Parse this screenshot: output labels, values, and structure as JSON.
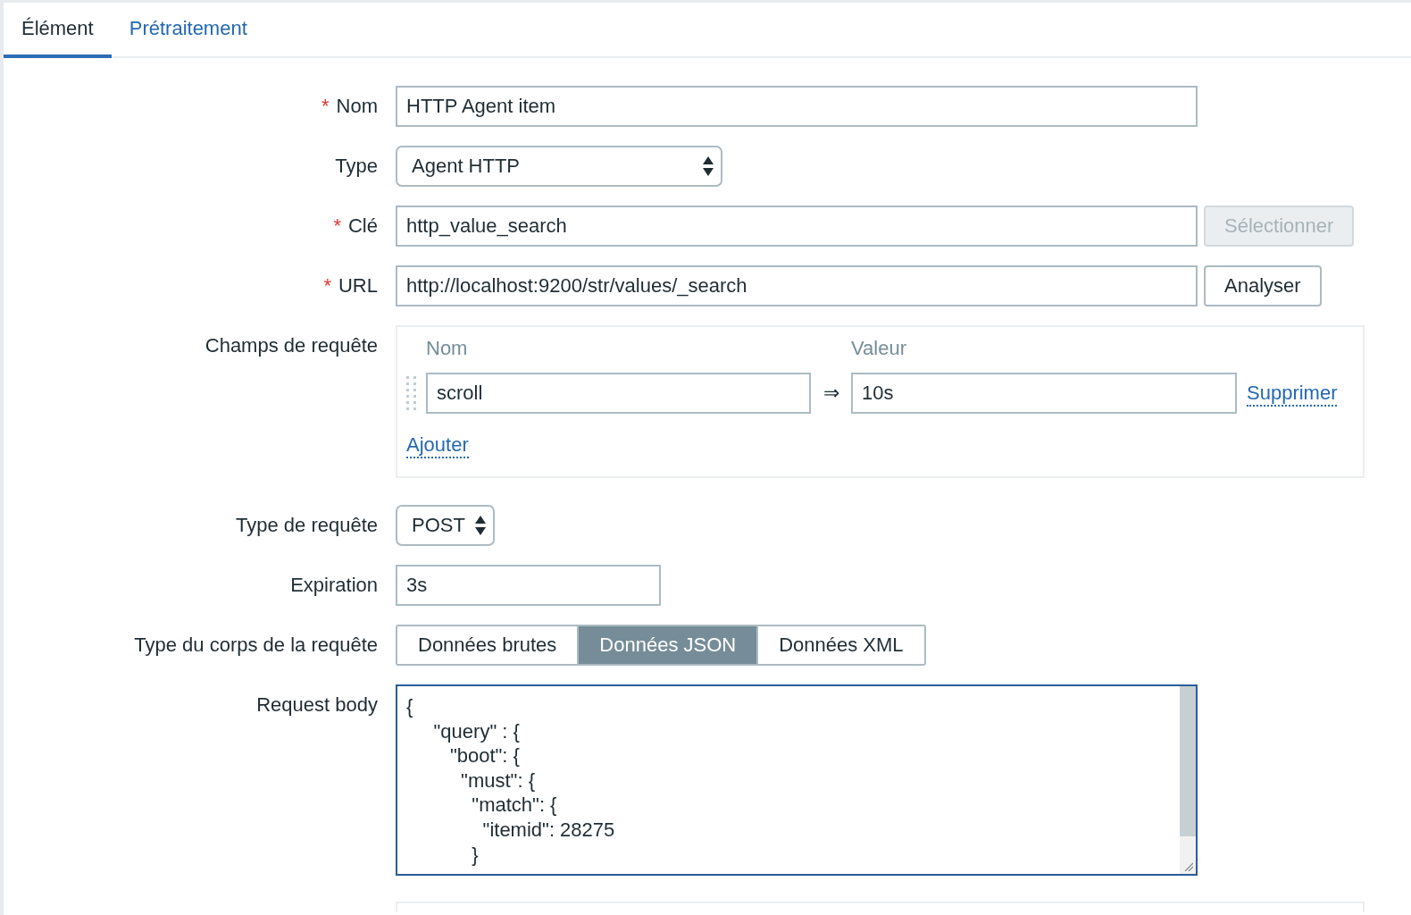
{
  "tabs": [
    {
      "label": "Élément",
      "selected": true
    },
    {
      "label": "Prétraitement",
      "selected": false
    }
  ],
  "form": {
    "rows": [
      {
        "kind": "text",
        "label": "Nom",
        "required_mark": "*",
        "value": "HTTP Agent item"
      },
      {
        "kind": "select",
        "label": "Type",
        "value": "Agent HTTP"
      },
      {
        "kind": "text",
        "label": "Clé",
        "required_mark": "*",
        "value": "http_value_search",
        "button": {
          "label": "Sélectionner",
          "disabled": true
        }
      },
      {
        "kind": "text",
        "label": "URL",
        "required_mark": "*",
        "value": "http://localhost:9200/str/values/_search",
        "button": {
          "label": "Analyser",
          "disabled": false
        }
      },
      {
        "kind": "pairs",
        "label": "Champs de requête",
        "columns": [
          "Nom",
          "Valeur"
        ],
        "pairs": [
          {
            "name": "scroll",
            "separator": "⇒",
            "value": "10s",
            "remove_link": "Supprimer"
          }
        ],
        "add_link": "Ajouter"
      },
      {
        "kind": "select",
        "label": "Type de requête",
        "value": "POST"
      },
      {
        "kind": "text",
        "label": "Expiration",
        "value": "3s"
      },
      {
        "kind": "segmented",
        "label": "Type du corps de la requête",
        "options": [
          {
            "label": "Données brutes",
            "selected": false
          },
          {
            "label": "Données JSON",
            "selected": true
          },
          {
            "label": "Données XML",
            "selected": false
          }
        ]
      },
      {
        "kind": "textarea",
        "label": "Request body",
        "value": "{\n     \"query\" : {\n        \"boot\": {\n          \"must\": {\n            \"match\": {\n              \"itemid\": 28275\n            }"
      }
    ]
  }
}
